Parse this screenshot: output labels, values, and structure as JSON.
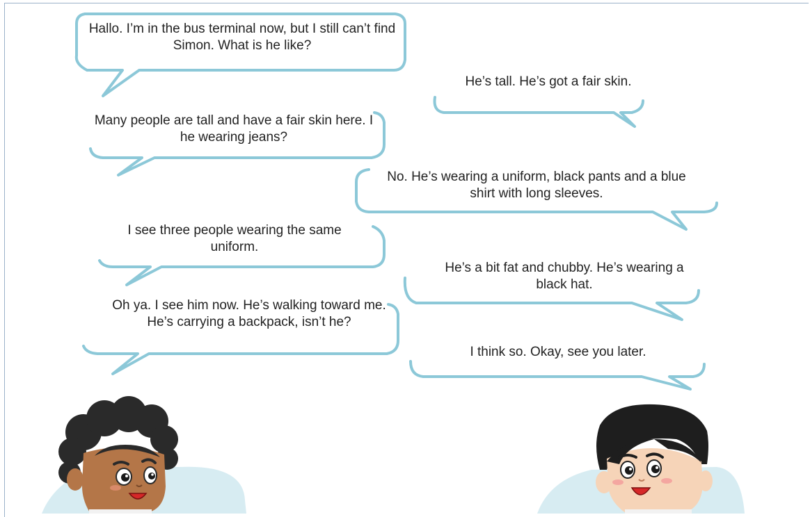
{
  "dialogue": [
    {
      "speaker": "left",
      "text": "Hallo. I’m in the bus terminal now, but I still can’t find Simon. What is he like?"
    },
    {
      "speaker": "right",
      "text": "He’s tall. He’s got a fair skin."
    },
    {
      "speaker": "left",
      "text": "Many people are tall and have a fair skin here. I he wearing jeans?"
    },
    {
      "speaker": "right",
      "text": "No. He’s wearing a uniform, black pants and a blue shirt with long sleeves."
    },
    {
      "speaker": "left",
      "text": "I see three people wearing the same uniform."
    },
    {
      "speaker": "right",
      "text": "He’s a bit fat and chubby. He’s wearing a black hat."
    },
    {
      "speaker": "left",
      "text": "Oh ya. I see him now. He’s walking toward me. He’s carrying a backpack, isn’t he?"
    },
    {
      "speaker": "right",
      "text": "I think so. Okay, see you later."
    }
  ],
  "colors": {
    "bubble_outline": "#8cc8d8",
    "bubble_fill": "#ffffff",
    "backdrop": "#d7ecf2",
    "text": "#222222"
  },
  "characters": [
    {
      "name": "curly-haired-boy",
      "side": "left"
    },
    {
      "name": "black-haired-boy",
      "side": "right"
    }
  ]
}
